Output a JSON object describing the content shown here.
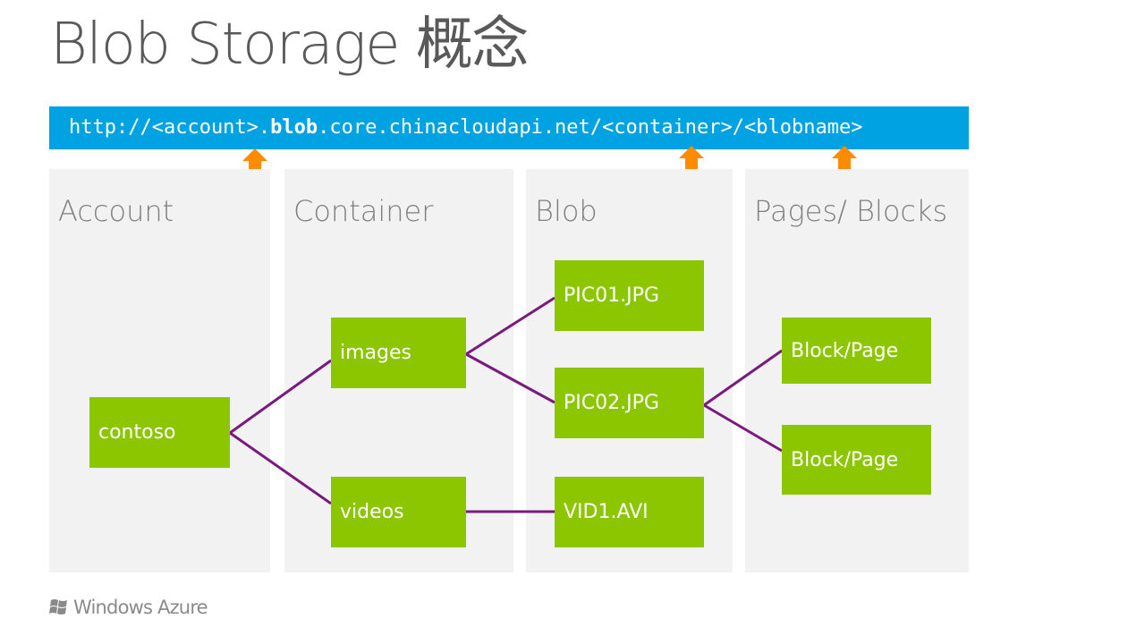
{
  "title": "Blob Storage 概念",
  "url": {
    "prefix": "http://<account>.",
    "bold": "blob",
    "suffix": ".core.chinacloudapi.net/<container>/<blobname>"
  },
  "colors": {
    "url_bar": "#00a2e2",
    "node": "#8cc600",
    "link": "#7a1a7f",
    "arrow": "#ff8c00",
    "panel": "#f2f2f2"
  },
  "panels": [
    {
      "title": "Account"
    },
    {
      "title": "Container"
    },
    {
      "title": "Blob"
    },
    {
      "title": "Pages/ Blocks"
    }
  ],
  "nodes": {
    "contoso": "contoso",
    "images": "images",
    "videos": "videos",
    "pic01": "PIC01.JPG",
    "pic02": "PIC02.JPG",
    "vid1": "VID1.AVI",
    "block1": "Block/Page",
    "block2": "Block/Page"
  },
  "links": [
    [
      "contoso",
      "images"
    ],
    [
      "contoso",
      "videos"
    ],
    [
      "images",
      "pic01"
    ],
    [
      "images",
      "pic02"
    ],
    [
      "videos",
      "vid1"
    ],
    [
      "pic02",
      "block1"
    ],
    [
      "pic02",
      "block2"
    ]
  ],
  "arrows": [
    "account",
    "container",
    "blobname"
  ],
  "footer": {
    "logo_text": "Windows Azure"
  }
}
